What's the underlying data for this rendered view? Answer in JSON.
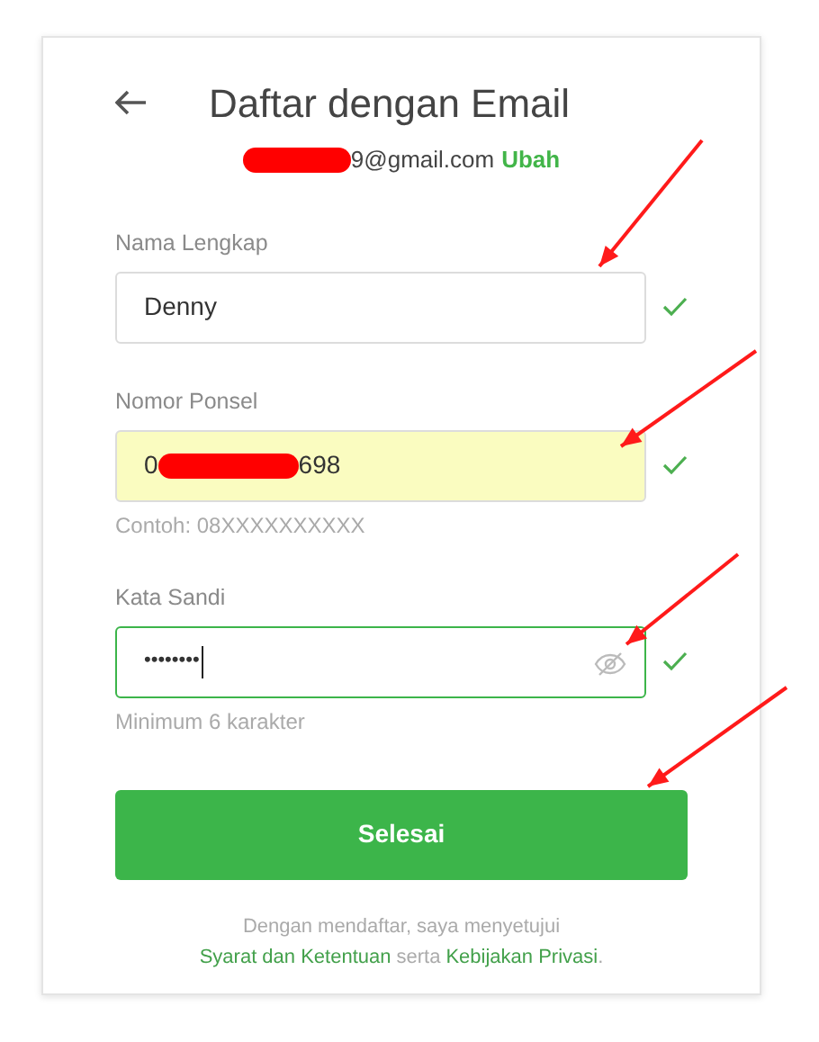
{
  "header": {
    "title": "Daftar dengan Email",
    "email_visible": "9@gmail.com",
    "change_link": "Ubah"
  },
  "fields": [
    {
      "kind": "text",
      "label": "Nama Lengkap",
      "value_parts": [
        "Denny"
      ],
      "redacted": false,
      "valid": true,
      "focused": false,
      "autofilled": false
    },
    {
      "kind": "phone",
      "label": "Nomor Ponsel",
      "value_parts": [
        "0",
        "698"
      ],
      "redacted": true,
      "valid": true,
      "focused": false,
      "autofilled": true,
      "hint": "Contoh: 08XXXXXXXXXX"
    },
    {
      "kind": "password",
      "label": "Kata Sandi",
      "value_parts": [
        "••••••••"
      ],
      "redacted": false,
      "valid": true,
      "focused": true,
      "autofilled": false,
      "revealed": false,
      "hint": "Minimum 6 karakter"
    }
  ],
  "submit": "Selesai",
  "terms": {
    "intro": "Dengan mendaftar, saya menyetujui",
    "link1": "Syarat dan Ketentuan",
    "middle": "serta",
    "link2": "Kebijakan Privasi",
    "end": "."
  }
}
